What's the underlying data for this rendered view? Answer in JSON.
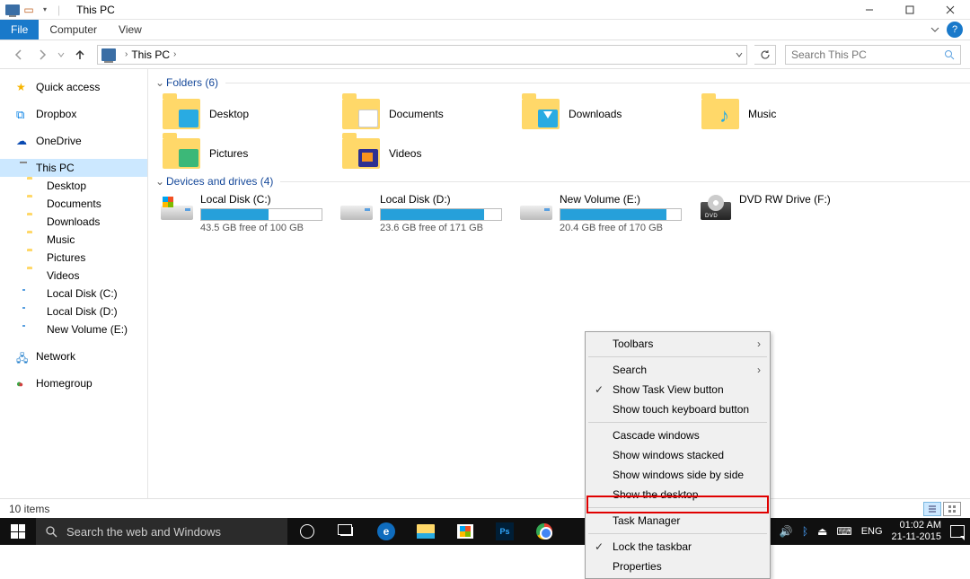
{
  "window": {
    "title": "This PC"
  },
  "ribbon": {
    "tabs": {
      "file": "File",
      "computer": "Computer",
      "view": "View"
    }
  },
  "addr": {
    "crumb0": "This PC",
    "search_placeholder": "Search This PC"
  },
  "nav": {
    "quick": "Quick access",
    "dropbox": "Dropbox",
    "onedrive": "OneDrive",
    "thispc": "This PC",
    "desktop": "Desktop",
    "documents": "Documents",
    "downloads": "Downloads",
    "music": "Music",
    "pictures": "Pictures",
    "videos": "Videos",
    "ldc": "Local Disk (C:)",
    "ldd": "Local Disk (D:)",
    "nve": "New Volume (E:)",
    "network": "Network",
    "homegroup": "Homegroup"
  },
  "groups": {
    "folders_hdr": "Folders (6)",
    "drives_hdr": "Devices and drives (4)"
  },
  "folders": {
    "desktop": "Desktop",
    "documents": "Documents",
    "downloads": "Downloads",
    "music": "Music",
    "pictures": "Pictures",
    "videos": "Videos"
  },
  "drives": {
    "c": {
      "name": "Local Disk (C:)",
      "free": "43.5 GB free of 100 GB",
      "pct": 56
    },
    "d": {
      "name": "Local Disk (D:)",
      "free": "23.6 GB free of 171 GB",
      "pct": 86
    },
    "e": {
      "name": "New Volume (E:)",
      "free": "20.4 GB free of 170 GB",
      "pct": 88
    },
    "f": {
      "name": "DVD RW Drive (F:)"
    }
  },
  "status": {
    "items": "10 items"
  },
  "taskbar": {
    "search_placeholder": "Search the web and Windows",
    "lang": "ENG",
    "time": "01:02 AM",
    "date": "21-11-2015"
  },
  "ctx": {
    "toolbars": "Toolbars",
    "search": "Search",
    "show_taskview": "Show Task View button",
    "show_touchkb": "Show touch keyboard button",
    "cascade": "Cascade windows",
    "stacked": "Show windows stacked",
    "sidebyside": "Show windows side by side",
    "showdesktop": "Show the desktop",
    "taskmgr": "Task Manager",
    "lock": "Lock the taskbar",
    "properties": "Properties"
  }
}
